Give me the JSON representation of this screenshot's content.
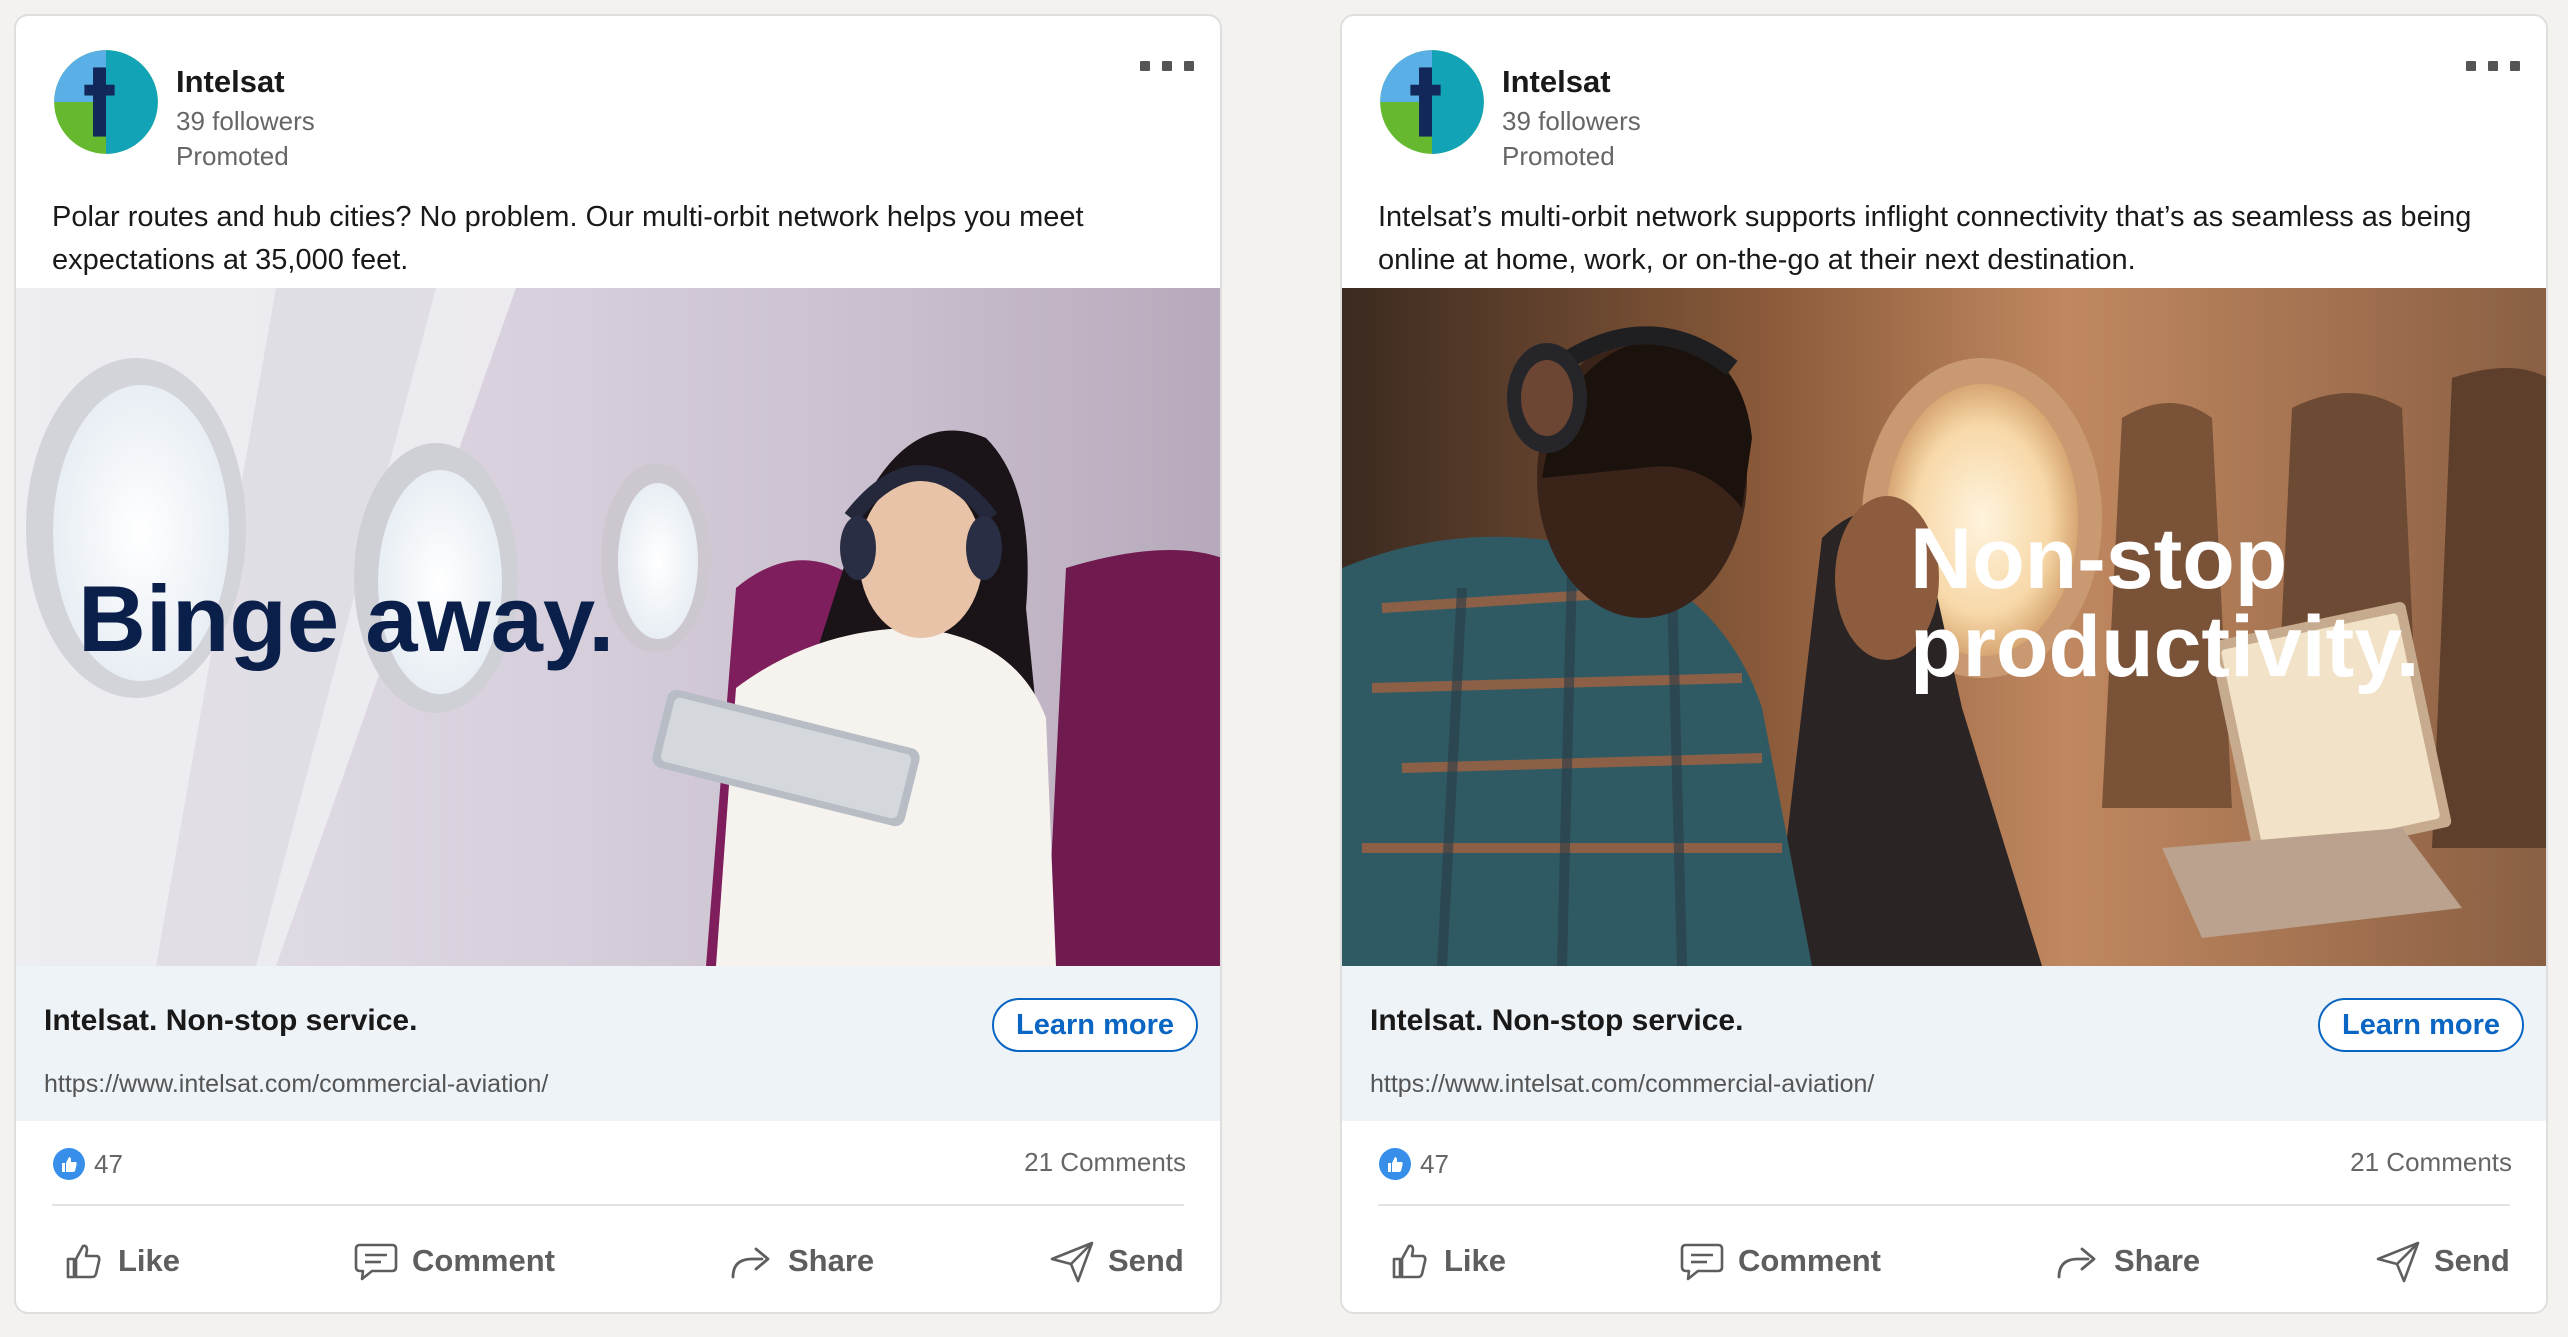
{
  "cards": [
    {
      "company": "Intelsat",
      "followers": "39 followers",
      "promoted": "Promoted",
      "post_text": "Polar routes and hub cities? No problem. Our multi-orbit network helps you meet expectations at 35,000 feet.",
      "image_headline": "Binge away.",
      "link_headline": "Intelsat. Non-stop service.",
      "link_url": "https://www.intelsat.com/commercial-aviation/",
      "cta": "Learn more",
      "reactions": "47",
      "comments": "21 Comments",
      "actions": {
        "like": "Like",
        "comment": "Comment",
        "share": "Share",
        "send": "Send"
      }
    },
    {
      "company": "Intelsat",
      "followers": "39 followers",
      "promoted": "Promoted",
      "post_text": "Intelsat’s multi-orbit network supports inflight connectivity that’s as seamless as being online at home, work, or on-the-go at their next destination.",
      "image_headline_line1": "Non-stop",
      "image_headline_line2": "productivity.",
      "link_headline": "Intelsat. Non-stop service.",
      "link_url": "https://www.intelsat.com/commercial-aviation/",
      "cta": "Learn more",
      "reactions": "47",
      "comments": "21 Comments",
      "actions": {
        "like": "Like",
        "comment": "Comment",
        "share": "Share",
        "send": "Send"
      }
    }
  ],
  "colors": {
    "accent": "#0a66c2",
    "link_bar_bg": "#eef3f8",
    "headline_navy": "#0b1f4b",
    "logo_light_blue": "#5ab0e6",
    "logo_teal": "#12a3b7",
    "logo_green": "#66b92f",
    "logo_navy": "#12275a"
  },
  "icons": [
    "more-icon",
    "like-reaction-icon",
    "thumbs-up-icon",
    "comment-icon",
    "share-icon",
    "send-icon"
  ]
}
